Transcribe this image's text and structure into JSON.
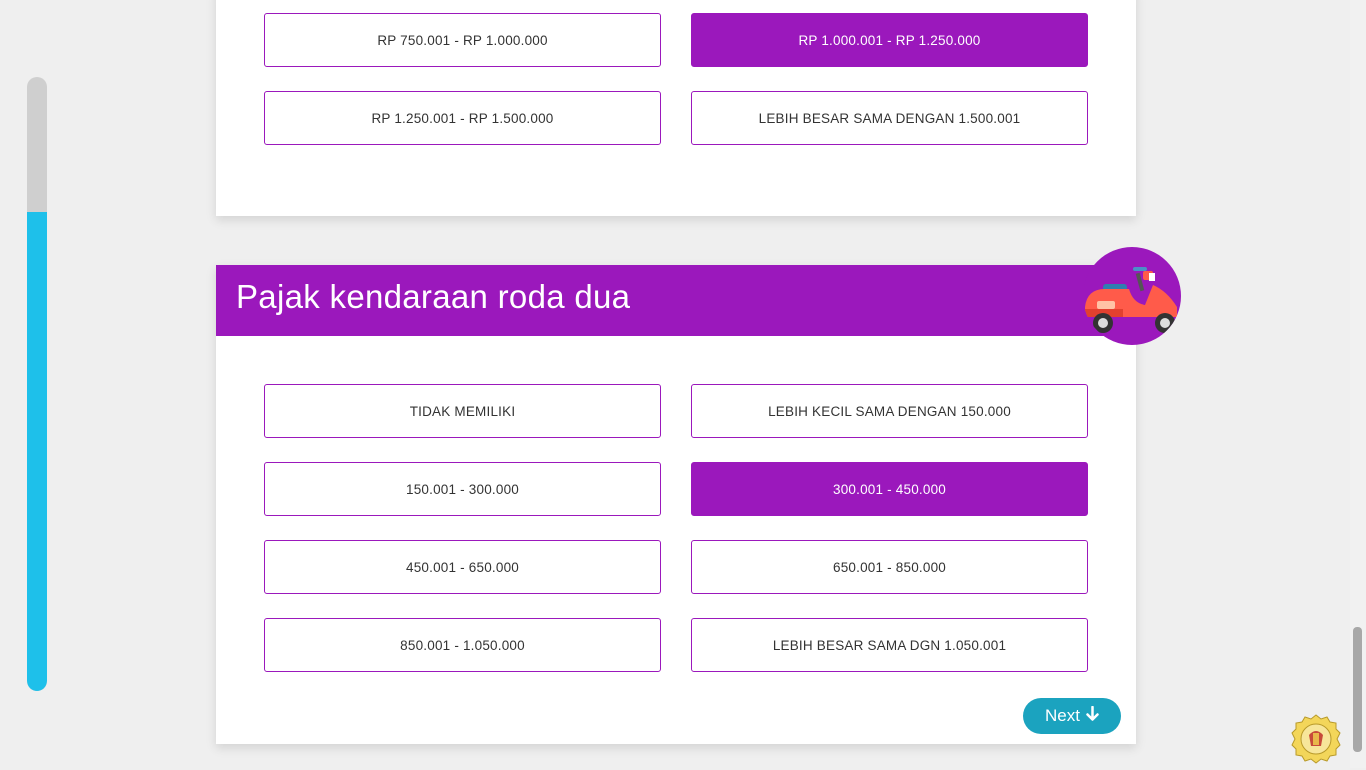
{
  "progress": {
    "fraction": 0.78
  },
  "income_section": {
    "options": [
      {
        "label": "RP 750.001 - RP 1.000.000",
        "selected": false
      },
      {
        "label": "RP 1.000.001 - RP 1.250.000",
        "selected": true
      },
      {
        "label": "RP 1.250.001 - RP 1.500.000",
        "selected": false
      },
      {
        "label": "LEBIH BESAR SAMA DENGAN 1.500.001",
        "selected": false
      }
    ]
  },
  "vehicle_tax_section": {
    "title": "Pajak kendaraan roda dua",
    "icon": "scooter-icon",
    "options": [
      {
        "label": "TIDAK MEMILIKI",
        "selected": false
      },
      {
        "label": "LEBIH KECIL SAMA DENGAN 150.000",
        "selected": false
      },
      {
        "label": "150.001 - 300.000",
        "selected": false
      },
      {
        "label": "300.001 - 450.000",
        "selected": true
      },
      {
        "label": "450.001 - 650.000",
        "selected": false
      },
      {
        "label": "650.001 - 850.000",
        "selected": false
      },
      {
        "label": "850.001 - 1.050.000",
        "selected": false
      },
      {
        "label": "LEBIH BESAR SAMA DGN 1.050.001",
        "selected": false
      }
    ]
  },
  "next_button": {
    "label": "Next",
    "icon": "arrow-down-icon"
  },
  "colors": {
    "accent": "#9b18bc",
    "progress": "#1ec0ea",
    "next": "#1ba3bf"
  }
}
